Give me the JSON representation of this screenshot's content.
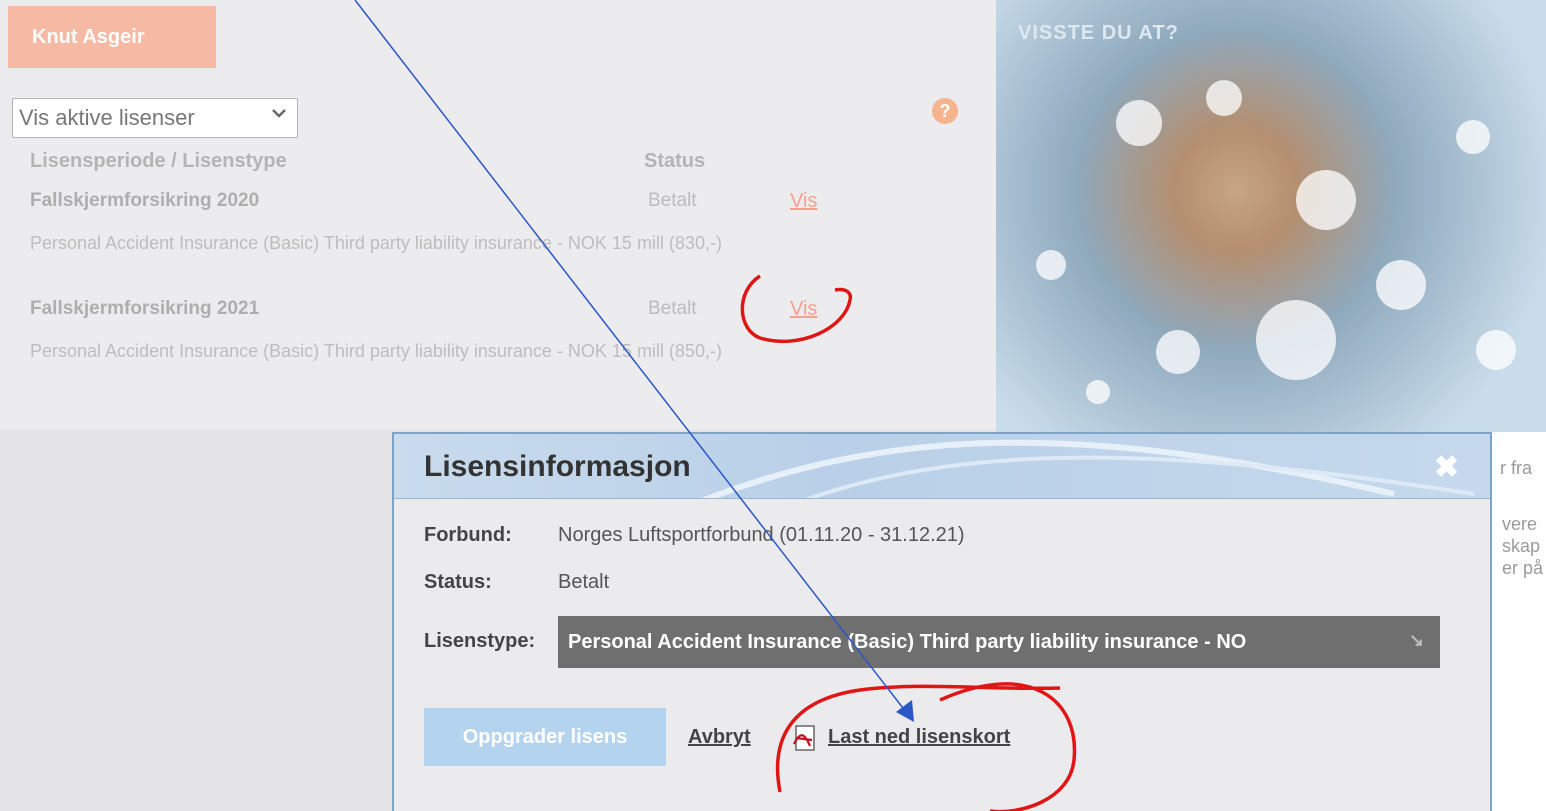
{
  "user": {
    "name": "Knut Asgeir"
  },
  "filter": {
    "selected": "Vis aktive lisenser"
  },
  "table": {
    "col_period": "Lisensperiode / Lisenstype",
    "col_status": "Status",
    "rows": [
      {
        "title": "Fallskjermforsikring 2020",
        "status": "Betalt",
        "link": "Vis",
        "desc": "Personal Accident Insurance (Basic) Third party liability insurance - NOK 15 mill (830,-)"
      },
      {
        "title": "Fallskjermforsikring 2021",
        "status": "Betalt",
        "link": "Vis",
        "desc": "Personal Accident Insurance (Basic) Third party liability insurance - NOK 15 mill (850,-)"
      }
    ]
  },
  "help": {
    "icon": "?"
  },
  "ad": {
    "title": "VISSTE DU AT?"
  },
  "side_fragments": [
    "r fra",
    "vere",
    "skap",
    "er på"
  ],
  "modal": {
    "title": "Lisensinformasjon",
    "close_icon": "✖",
    "forbund_label": "Forbund:",
    "forbund_value": "Norges Luftsportforbund (01.11.20 - 31.12.21)",
    "status_label": "Status:",
    "status_value": "Betalt",
    "type_label": "Lisenstype:",
    "type_value": "Personal Accident Insurance (Basic) Third party liability insurance - NO",
    "dropdown_arrow": "↘",
    "upgrade_label": "Oppgrader lisens",
    "cancel_label": "Avbryt",
    "download_label": "Last ned lisenskort"
  },
  "colors": {
    "accent_orange": "#f6b9a3",
    "link": "#f4a28f",
    "modal_border": "#7ea3c4",
    "annotation_red": "#e01515",
    "annotation_blue": "#2a56c6"
  }
}
